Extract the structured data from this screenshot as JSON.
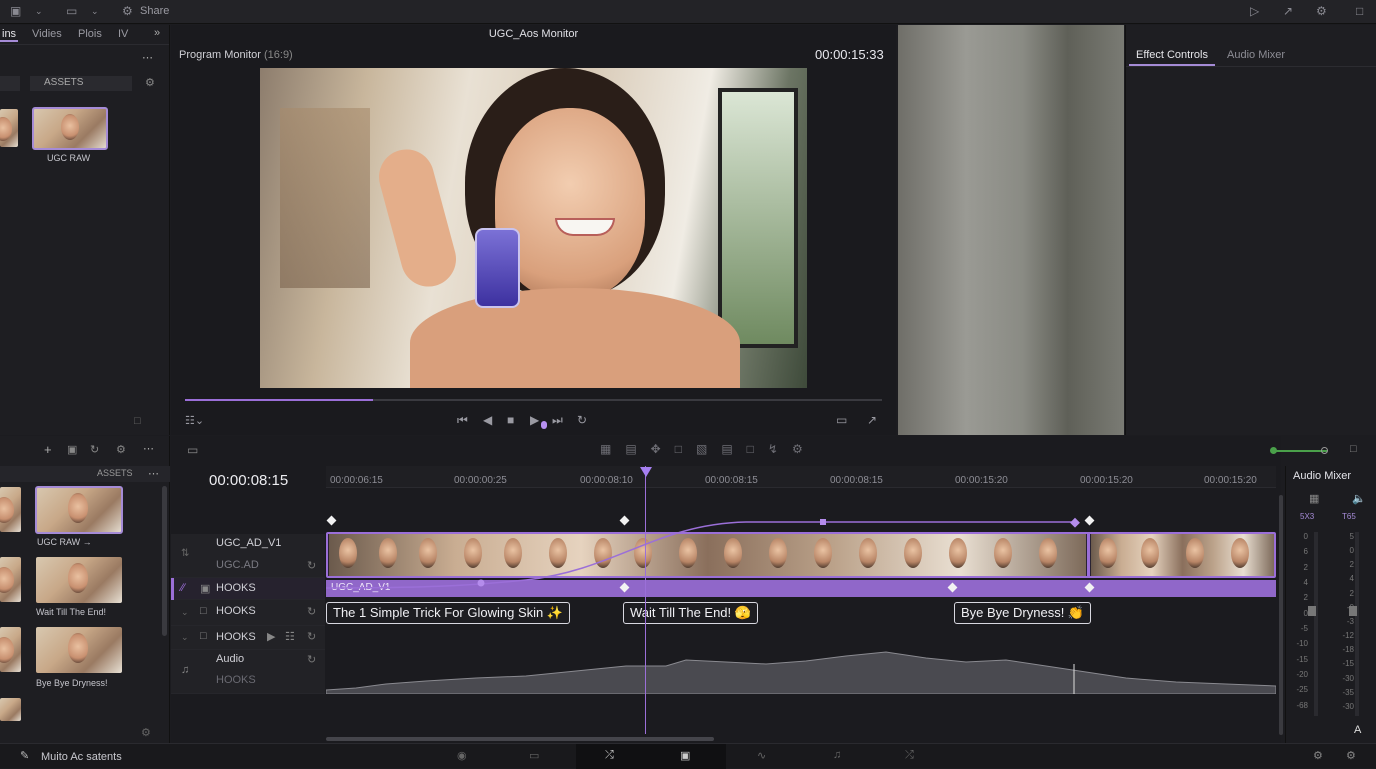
{
  "topbar": {
    "share_label": "Share"
  },
  "left_panel": {
    "tabs": [
      "ins",
      "Vidies",
      "Plois",
      "IV"
    ],
    "assets_label": "ASSETS",
    "thumb1_caption": "UGC RAW"
  },
  "media_panel": {
    "assets_label": "ASSETS",
    "captions": [
      "UGC RAW →",
      "Wait Till The End!",
      "Bye Bye Dryness!"
    ]
  },
  "monitor": {
    "window_title": "UGC_Aos Monitor",
    "panel_title": "Program Monitor",
    "aspect": "(16:9)",
    "timecode": "00:00:15:33",
    "progress": 0.27
  },
  "right_panel": {
    "tabs": [
      "Effect Controls",
      "Audio Mixer"
    ]
  },
  "timeline": {
    "timecode": "00:00:08:15",
    "ruler_labels": [
      "00:00:06:15",
      "00:00:00:25",
      "00:00:08:10",
      "00:00:08:15",
      "00:00:08:15",
      "00:00:15:20",
      "00:00:15:20",
      "00:00:15:20"
    ],
    "tracks": [
      {
        "name": "UGC_AD_V1",
        "sub": "UGC.AD"
      },
      {
        "name": "HOOKS"
      },
      {
        "name": "HOOKS"
      },
      {
        "name": "HOOKS"
      },
      {
        "name": "Audio",
        "sub": "HOOKS"
      }
    ],
    "clip_label": "UGC_AD_V1",
    "titles": [
      "The 1 Simple Trick For Glowing Skin ✨",
      "Wait Till The End! 🫣",
      "Bye Bye Dryness! 👏"
    ]
  },
  "audio_mixer": {
    "title": "Audio Mixer",
    "ch1": "5X3",
    "ch2": "T65",
    "scale_l": [
      "0",
      "6",
      "2",
      "4",
      "2",
      "0",
      "-5",
      "-10",
      "-15",
      "-20",
      "-25",
      "-68"
    ],
    "scale_r": [
      "5",
      "0",
      "2",
      "4",
      "2",
      "-0",
      "-3",
      "-12",
      "-18",
      "-15",
      "-30",
      "-35",
      "-30"
    ],
    "bottom_letter": "A"
  },
  "status": {
    "label": "Muito Ac satents"
  },
  "colors": {
    "accent": "#9b6fd8",
    "clip": "#8e62c9",
    "bg": "#1c1c20"
  }
}
